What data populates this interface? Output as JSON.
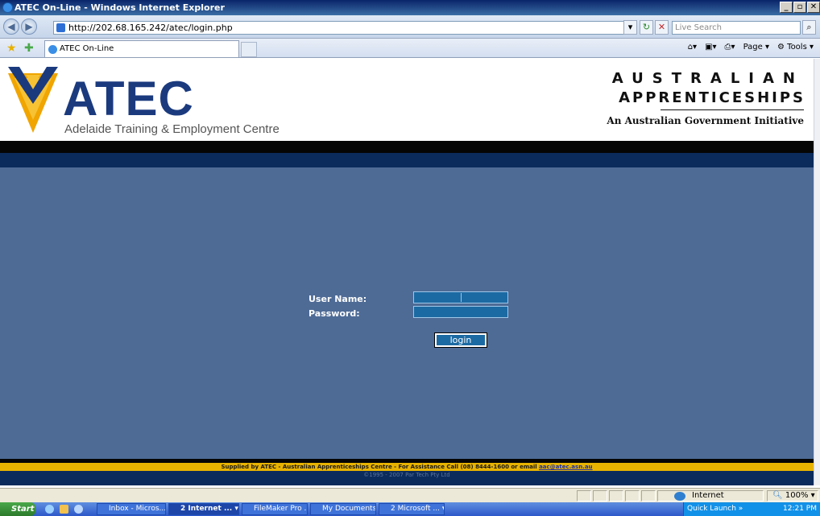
{
  "window": {
    "title": "ATEC On-Line - Windows Internet Explorer"
  },
  "browser": {
    "url": "http://202.68.165.242/atec/login.php",
    "search_placeholder": "Live Search",
    "tab_title": "ATEC On-Line",
    "tools": {
      "page": "Page",
      "tools": "Tools"
    }
  },
  "header": {
    "logo_name": "ATEC",
    "logo_subtitle": "Adelaide Training & Employment Centre",
    "aa_line1": "AUSTRALIAN",
    "aa_line2": "APPRENTICESHIPS",
    "aa_line3": "An Australian Government Initiative"
  },
  "login": {
    "username_label": "User Name:",
    "password_label": "Password:",
    "button_label": "login"
  },
  "footer": {
    "text": "Supplied by ATEC - Australian Apprenticeships Centre - For Assistance Call (08) 8444-1600 or email ",
    "email": "aac@atec.asn.au",
    "copyright": "©1995 - 2007 Par Tech Pty Ltd"
  },
  "statusbar": {
    "zone": "Internet",
    "zoom": "100%"
  },
  "taskbar": {
    "start": "Start",
    "items": [
      {
        "label": "Inbox - Micros..."
      },
      {
        "label": "2 Internet ..."
      },
      {
        "label": "FileMaker Pro ..."
      },
      {
        "label": "My Documents"
      },
      {
        "label": "2 Microsoft ..."
      }
    ],
    "quick_launch": "Quick Launch",
    "time": "12:21 PM"
  }
}
